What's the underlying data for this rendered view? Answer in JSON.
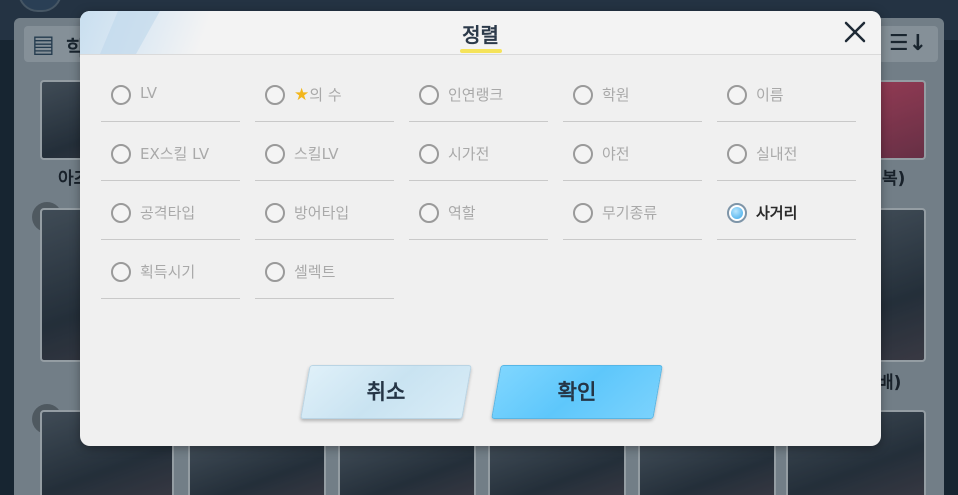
{
  "background": {
    "header_char": "힉",
    "sort_button_glyph": "☰↓",
    "card_label_left": "아즈",
    "card_label_right_1": "복)",
    "card_label_right_2": "배)"
  },
  "dialog": {
    "title": "정렬",
    "close_glyph": "✕",
    "options": [
      {
        "label": "LV",
        "selected": false
      },
      {
        "label": "의 수",
        "star": true,
        "selected": false
      },
      {
        "label": "인연랭크",
        "selected": false
      },
      {
        "label": "학원",
        "selected": false
      },
      {
        "label": "이름",
        "selected": false
      },
      {
        "label": "EX스킬 LV",
        "selected": false
      },
      {
        "label": "스킬LV",
        "selected": false
      },
      {
        "label": "시가전",
        "selected": false
      },
      {
        "label": "야전",
        "selected": false
      },
      {
        "label": "실내전",
        "selected": false
      },
      {
        "label": "공격타입",
        "selected": false
      },
      {
        "label": "방어타입",
        "selected": false
      },
      {
        "label": "역할",
        "selected": false
      },
      {
        "label": "무기종류",
        "selected": false
      },
      {
        "label": "사거리",
        "selected": true
      },
      {
        "label": "획득시기",
        "selected": false
      },
      {
        "label": "셀렉트",
        "selected": false
      }
    ],
    "cancel_label": "취소",
    "confirm_label": "확인"
  },
  "colors": {
    "accent": "#5ec7fb",
    "title_underline": "#f5e35a",
    "radio_selected": "#3aa7e8"
  }
}
